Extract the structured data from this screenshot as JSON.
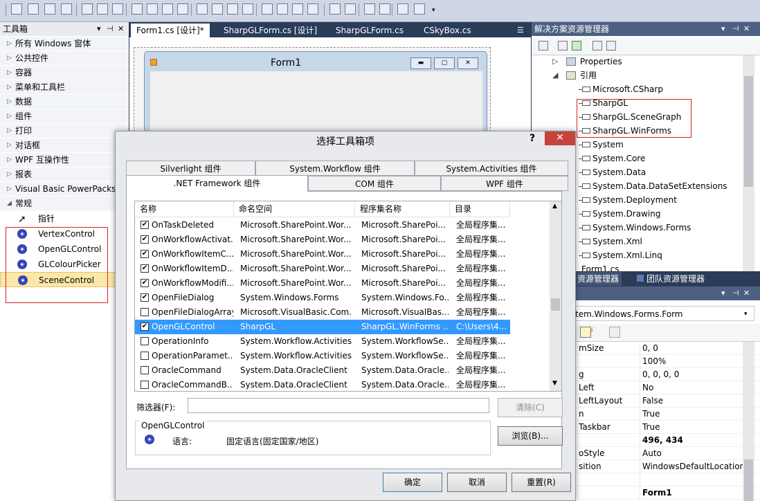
{
  "toolbox": {
    "title": "工具箱",
    "categories": [
      "所有 Windows 窗体",
      "公共控件",
      "容器",
      "菜单和工具栏",
      "数据",
      "组件",
      "打印",
      "对话框",
      "WPF 互操作性",
      "报表",
      "Visual Basic PowerPacks",
      "常规"
    ],
    "items": [
      "指针",
      "VertexControl",
      "OpenGLControl",
      "GLColourPicker",
      "SceneControl"
    ]
  },
  "doc_tabs": [
    "Form1.cs [设计]*",
    "SharpGLForm.cs [设计]",
    "SharpGLForm.cs",
    "CSkyBox.cs"
  ],
  "form": {
    "title": "Form1"
  },
  "solution_explorer": {
    "title": "解决方案资源管理器",
    "items": [
      "Properties",
      "引用",
      "Microsoft.CSharp",
      "SharpGL",
      "SharpGL.SceneGraph",
      "SharpGL.WinForms",
      "System",
      "System.Core",
      "System.Data",
      "System.Data.DataSetExtensions",
      "System.Deployment",
      "System.Drawing",
      "System.Windows.Forms",
      "System.Xml",
      "System.Xml.Linq",
      "Form1.cs"
    ]
  },
  "bottom_tabs": [
    "资源管理器",
    "团队资源管理器"
  ],
  "properties": {
    "object": "tem.Windows.Forms.Form",
    "rows": [
      {
        "name": "mSize",
        "value": "0, 0",
        "bold": false
      },
      {
        "name": "",
        "value": "100%",
        "bold": false
      },
      {
        "name": "g",
        "value": "0, 0, 0, 0",
        "bold": false
      },
      {
        "name": "Left",
        "value": "No",
        "bold": false
      },
      {
        "name": "LeftLayout",
        "value": "False",
        "bold": false
      },
      {
        "name": "n",
        "value": "True",
        "bold": false
      },
      {
        "name": "Taskbar",
        "value": "True",
        "bold": false
      },
      {
        "name": "",
        "value": "496, 434",
        "bold": true
      },
      {
        "name": "oStyle",
        "value": "Auto",
        "bold": false
      },
      {
        "name": "sition",
        "value": "WindowsDefaultLocation",
        "bold": false
      },
      {
        "name": "",
        "value": "",
        "bold": false
      },
      {
        "name": "",
        "value": "Form1",
        "bold": true
      }
    ]
  },
  "dialog": {
    "title": "选择工具箱项",
    "help": "?",
    "tabs_row1": [
      "Silverlight 组件",
      "System.Workflow 组件",
      "System.Activities 组件"
    ],
    "tabs_row2": [
      ".NET Framework 组件",
      "COM 组件",
      "WPF 组件"
    ],
    "columns": [
      "名称",
      "命名空间",
      "程序集名称",
      "目录"
    ],
    "rows": [
      {
        "checked": true,
        "name": "OnTaskDeleted",
        "ns": "Microsoft.SharePoint.Wor...",
        "asm": "Microsoft.SharePoi...",
        "dir": "全局程序集..."
      },
      {
        "checked": true,
        "name": "OnWorkflowActivat...",
        "ns": "Microsoft.SharePoint.Wor...",
        "asm": "Microsoft.SharePoi...",
        "dir": "全局程序集..."
      },
      {
        "checked": true,
        "name": "OnWorkflowItemC...",
        "ns": "Microsoft.SharePoint.Wor...",
        "asm": "Microsoft.SharePoi...",
        "dir": "全局程序集..."
      },
      {
        "checked": true,
        "name": "OnWorkflowItemD...",
        "ns": "Microsoft.SharePoint.Wor...",
        "asm": "Microsoft.SharePoi...",
        "dir": "全局程序集..."
      },
      {
        "checked": true,
        "name": "OnWorkflowModifi...",
        "ns": "Microsoft.SharePoint.Wor...",
        "asm": "Microsoft.SharePoi...",
        "dir": "全局程序集..."
      },
      {
        "checked": true,
        "name": "OpenFileDialog",
        "ns": "System.Windows.Forms",
        "asm": "System.Windows.Fo...",
        "dir": "全局程序集..."
      },
      {
        "checked": false,
        "name": "OpenFileDialogArray",
        "ns": "Microsoft.VisualBasic.Com...",
        "asm": "Microsoft.VisualBas...",
        "dir": "全局程序集..."
      },
      {
        "checked": true,
        "name": "OpenGLControl",
        "ns": "SharpGL",
        "asm": "SharpGL.WinForms ...",
        "dir": "C:\\Users\\4...",
        "selected": true
      },
      {
        "checked": false,
        "name": "OperationInfo",
        "ns": "System.Workflow.Activities",
        "asm": "System.WorkflowSe...",
        "dir": "全局程序集..."
      },
      {
        "checked": false,
        "name": "OperationParamet...",
        "ns": "System.Workflow.Activities",
        "asm": "System.WorkflowSe...",
        "dir": "全局程序集..."
      },
      {
        "checked": false,
        "name": "OracleCommand",
        "ns": "System.Data.OracleClient",
        "asm": "System.Data.Oracle...",
        "dir": "全局程序集..."
      },
      {
        "checked": false,
        "name": "OracleCommandB...",
        "ns": "System.Data.OracleClient",
        "asm": "System.Data.Oracle...",
        "dir": "全局程序集..."
      }
    ],
    "filter_label": "筛选器(F):",
    "filter_value": "",
    "clear_label": "清除(C)",
    "group_title": "OpenGLControl",
    "lang_label": "语言:",
    "lang_value": "固定语言(固定国家/地区)",
    "browse_label": "浏览(B)...",
    "ok_label": "确定",
    "cancel_label": "取消",
    "reset_label": "重置(R)"
  }
}
